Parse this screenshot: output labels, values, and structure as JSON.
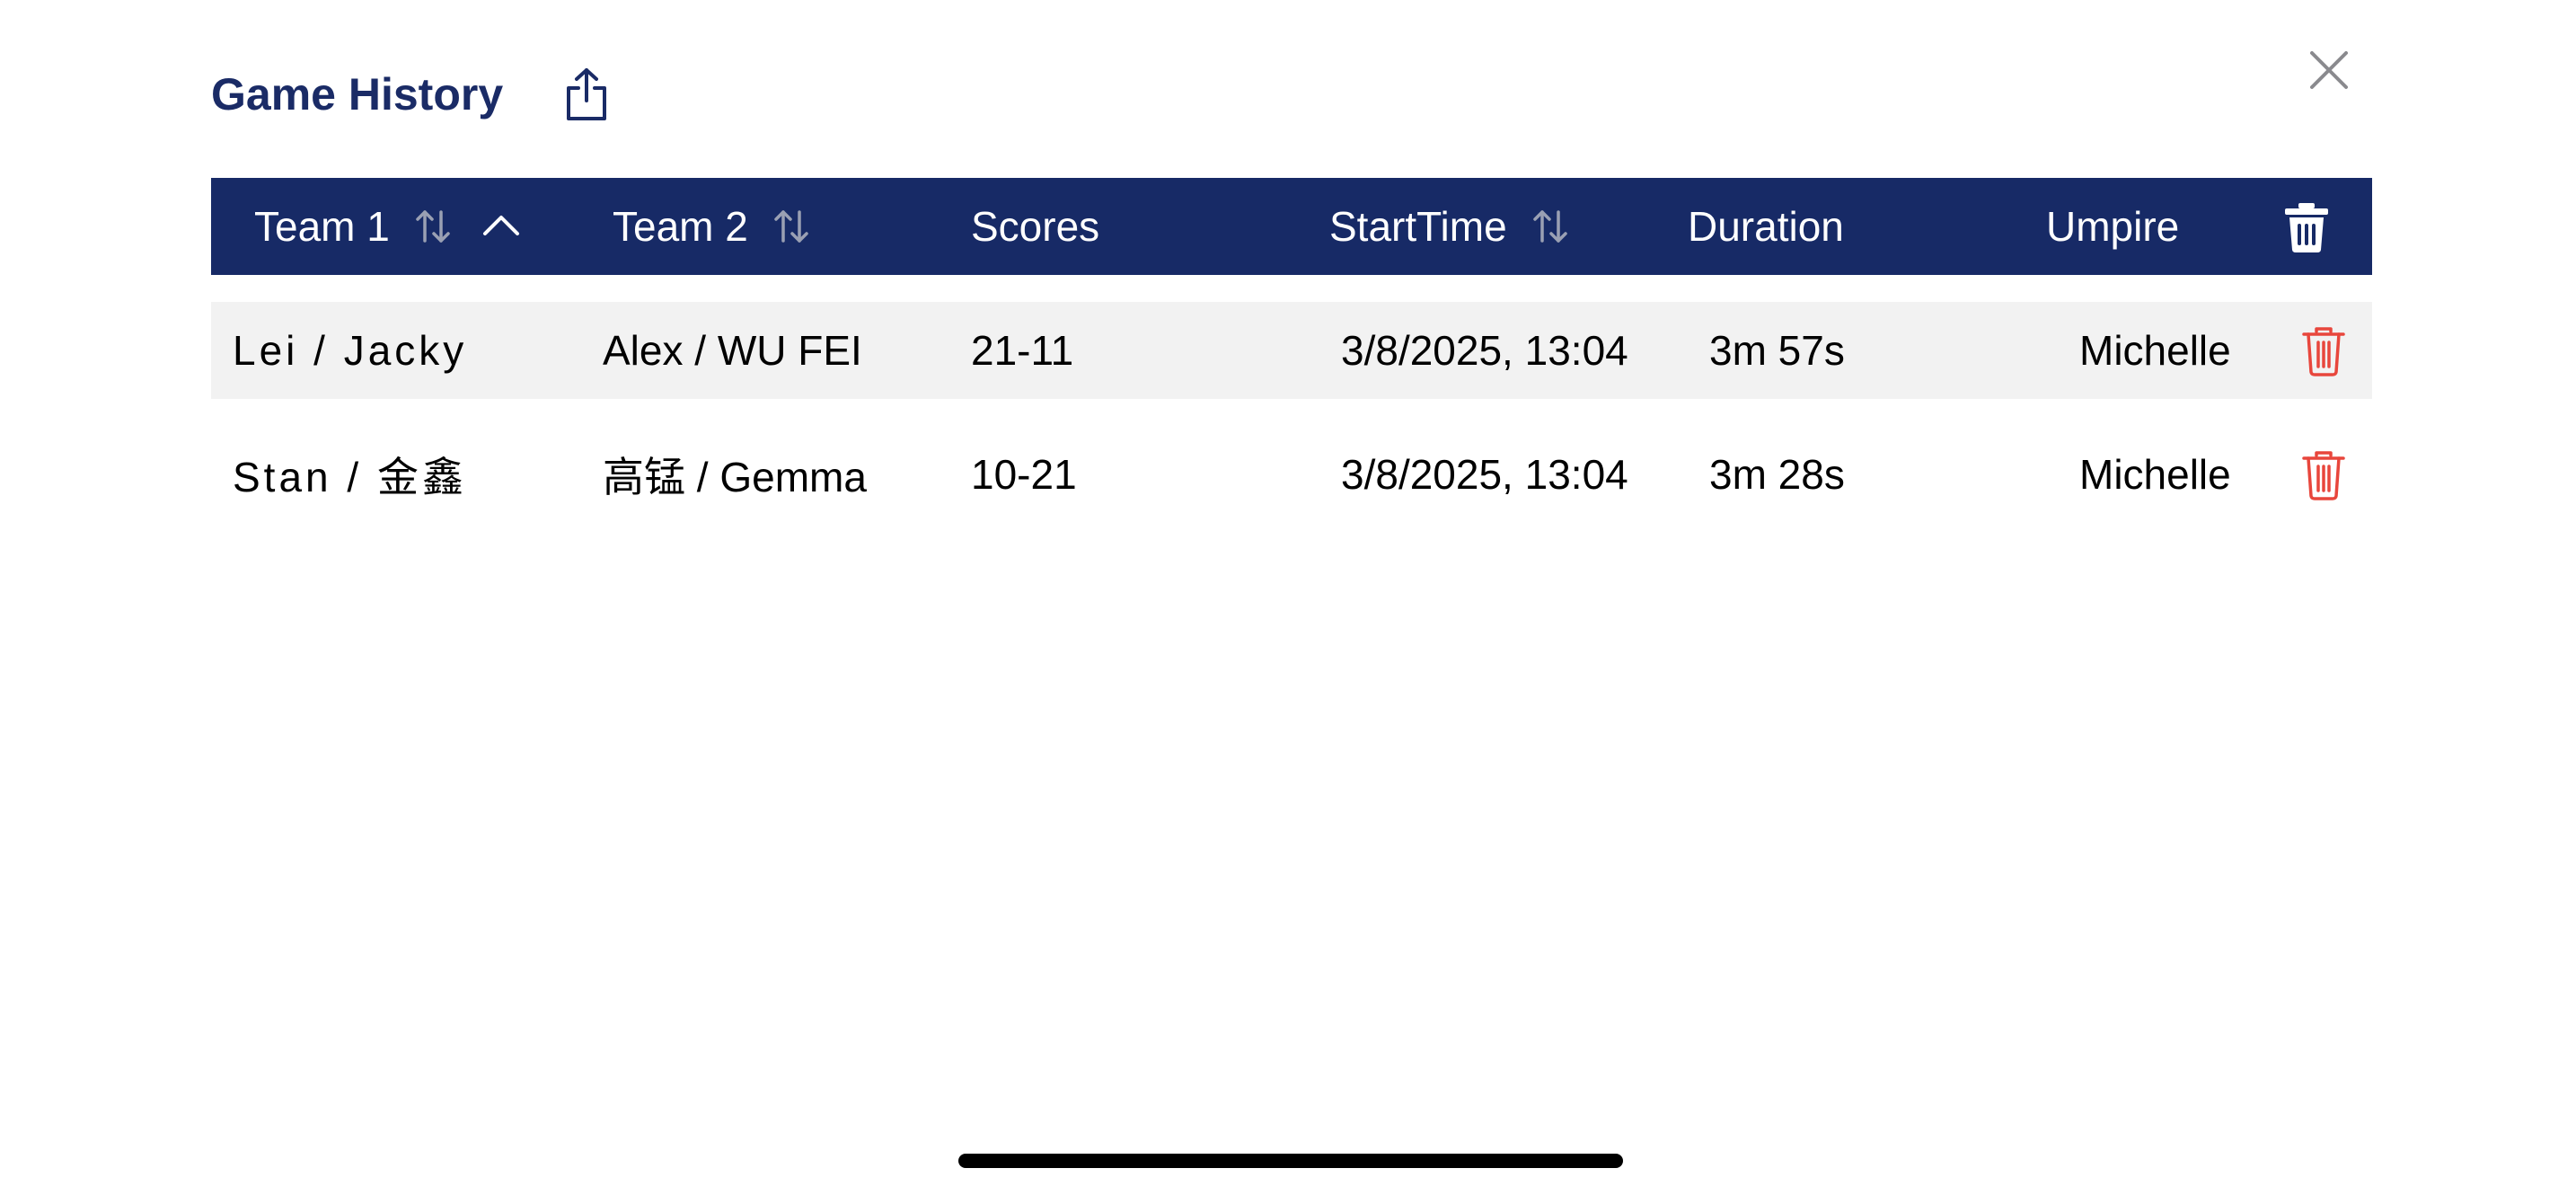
{
  "header": {
    "title": "Game History",
    "share_icon": "share-icon",
    "close_icon": "close-icon"
  },
  "table": {
    "columns": [
      {
        "key": "team1",
        "label": "Team 1",
        "sortable": true,
        "active_sort": "ascending"
      },
      {
        "key": "team2",
        "label": "Team 2",
        "sortable": true
      },
      {
        "key": "scores",
        "label": "Scores",
        "sortable": false
      },
      {
        "key": "start_time",
        "label": "StartTime",
        "sortable": true
      },
      {
        "key": "duration",
        "label": "Duration",
        "sortable": false
      },
      {
        "key": "umpire",
        "label": "Umpire",
        "sortable": false
      }
    ],
    "header_delete_icon": "trash-icon",
    "rows": [
      {
        "team1": "Lei / Jacky",
        "team2": "Alex / WU FEI",
        "scores": "21-11",
        "start_time": "3/8/2025, 13:04",
        "duration": "3m 57s",
        "umpire": "Michelle"
      },
      {
        "team1": "Stan / 金鑫",
        "team2": "高锰 / Gemma",
        "scores": "10-21",
        "start_time": "3/8/2025, 13:04",
        "duration": "3m 28s",
        "umpire": "Michelle"
      }
    ]
  },
  "colors": {
    "brand_navy": "#172a66",
    "title_navy": "#1a2b66",
    "delete_red": "#e8463c",
    "row_alt": "#f2f2f2"
  }
}
